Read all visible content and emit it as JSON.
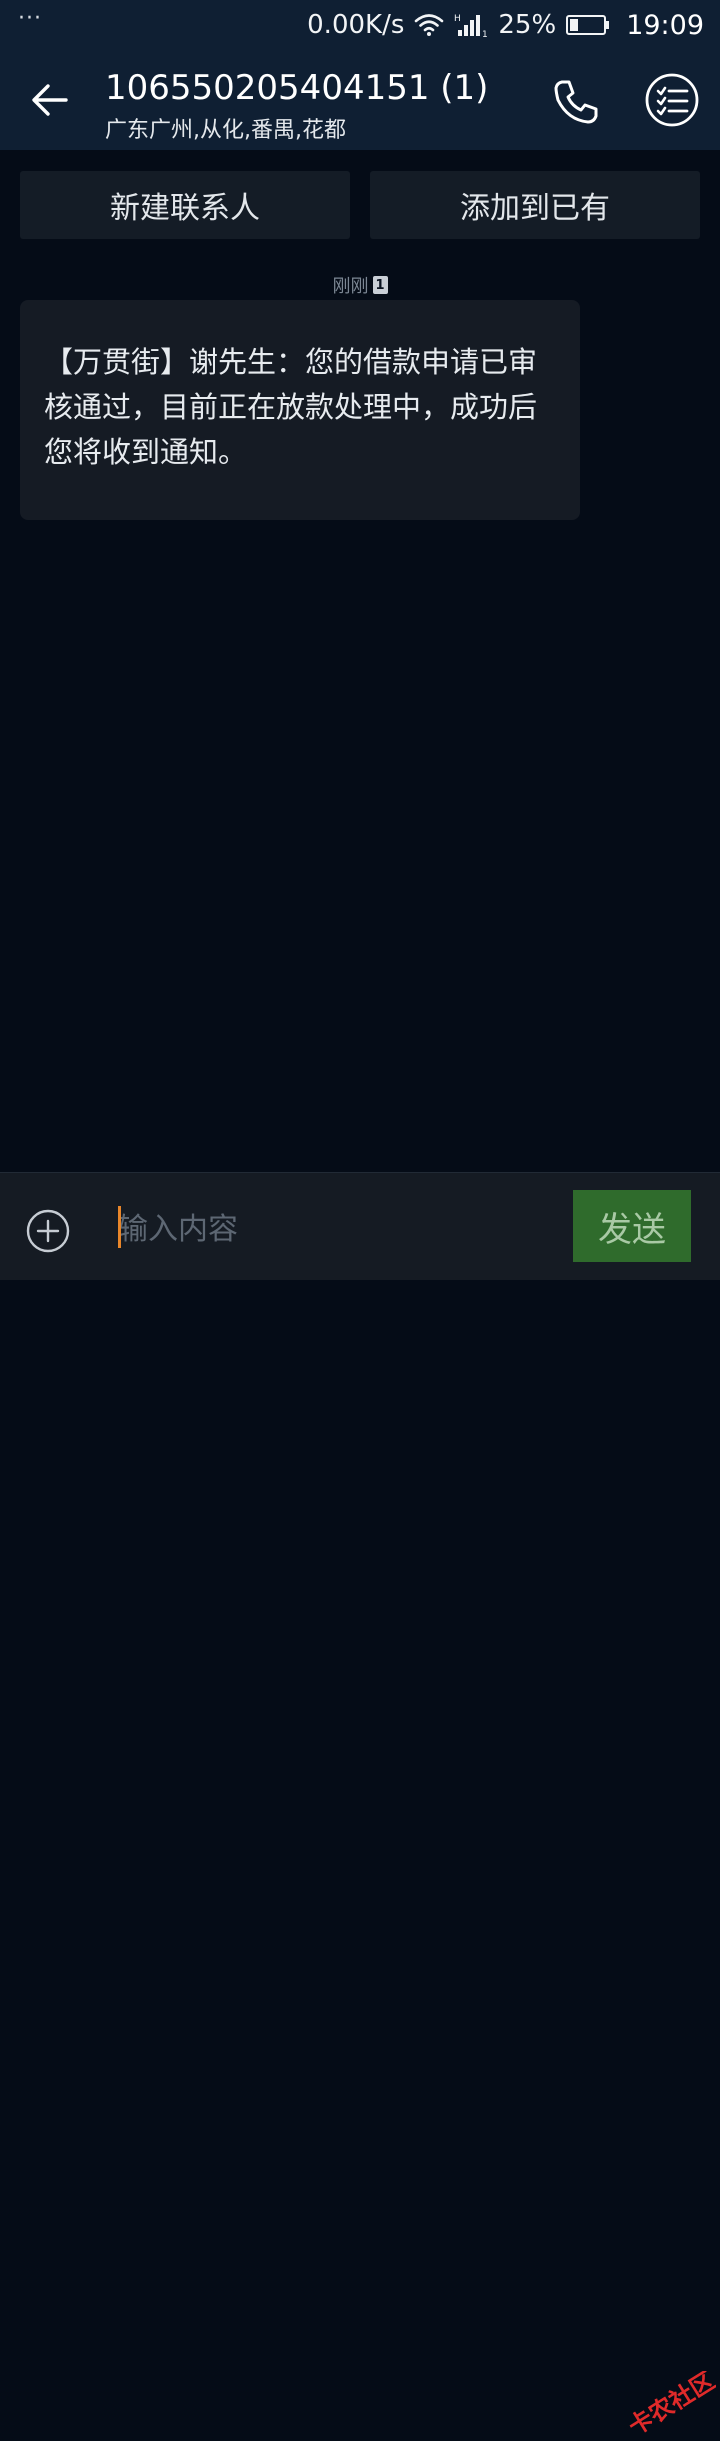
{
  "status_bar": {
    "dots": "···",
    "net_speed": "0.00K/s",
    "battery_percent": "25%",
    "battery_level": 0.25,
    "time": "19:09",
    "icons": [
      "wifi-icon",
      "signal-icon",
      "battery-icon"
    ]
  },
  "header": {
    "title": "106550205404151 (1)",
    "subtitle": "广东广州,从化,番禺,花都",
    "icons": [
      "back-arrow-icon",
      "phone-icon",
      "menu-list-icon"
    ]
  },
  "actions": {
    "new_contact": "新建联系人",
    "add_to_existing": "添加到已有"
  },
  "messages": [
    {
      "timestamp": "刚刚",
      "sim": "1",
      "text": "【万贯街】谢先生：您的借款申请已审核通过，目前正在放款处理中，成功后您将收到通知。"
    }
  ],
  "composer": {
    "placeholder": "输入内容",
    "value": "",
    "send_label": "发送",
    "add_icon": "add-circle-icon"
  },
  "colors": {
    "background": "#050c17",
    "header": "#0f1f33",
    "bubble": "#151b24",
    "send_button": "#2f6b2c",
    "cursor": "#e8862a"
  }
}
